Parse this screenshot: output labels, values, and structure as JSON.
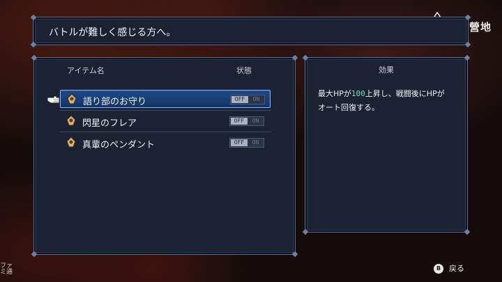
{
  "title_bar": {
    "text": "バトルが難しく感じる方へ。"
  },
  "list": {
    "header_name": "アイテム名",
    "header_status": "状態",
    "items": [
      {
        "label": "語り部のお守り",
        "off": "OFF",
        "on": "ON",
        "selected": true
      },
      {
        "label": "閃星のフレア",
        "off": "OFF",
        "on": "ON",
        "selected": false
      },
      {
        "label": "真輩のペンダント",
        "off": "OFF",
        "on": "ON",
        "selected": false
      }
    ]
  },
  "effect": {
    "title": "効果",
    "line1_pre": "最大HPが",
    "line1_num": "100",
    "line1_post": "上昇し、戦闘後にHPが",
    "line2": "オート回復する。"
  },
  "footer": {
    "button": "B",
    "back_label": "戻る"
  },
  "logo": {
    "text": "篝火營地"
  },
  "watermark": {
    "text": "ファミ通"
  },
  "colors": {
    "panel": "#1a2234",
    "selected": "#1e4a88",
    "highlight_num": "#6fe0b0"
  }
}
